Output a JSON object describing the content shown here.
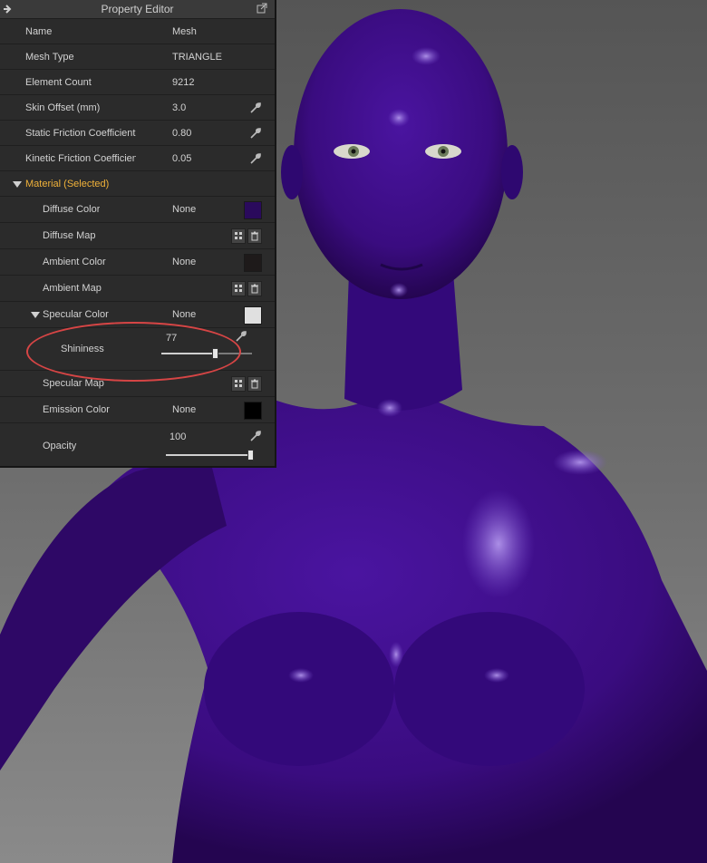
{
  "panel": {
    "title": "Property Editor",
    "rows": [
      {
        "label": "Name",
        "value": "Mesh"
      },
      {
        "label": "Mesh Type",
        "value": "TRIANGLE"
      },
      {
        "label": "Element Count",
        "value": "9212"
      },
      {
        "label": "Skin Offset (mm)",
        "value": "3.0"
      },
      {
        "label": "Static Friction Coefficient",
        "value": "0.80"
      },
      {
        "label": "Kinetic Friction Coefficient",
        "value": "0.05"
      }
    ],
    "material": {
      "title": "Material (Selected)",
      "diffuse_color": {
        "label": "Diffuse Color",
        "value": "None",
        "color": "#2a0a5c"
      },
      "diffuse_map": {
        "label": "Diffuse Map"
      },
      "ambient_color": {
        "label": "Ambient Color",
        "value": "None",
        "color": "#1e1a1a"
      },
      "ambient_map": {
        "label": "Ambient Map"
      },
      "specular_color": {
        "label": "Specular Color",
        "value": "None",
        "color": "#e0e0e0"
      },
      "shininess": {
        "label": "Shininess",
        "value": "77",
        "level": 0.59
      },
      "specular_map": {
        "label": "Specular Map"
      },
      "emission_color": {
        "label": "Emission Color",
        "value": "None",
        "color": "#000000"
      },
      "opacity": {
        "label": "Opacity",
        "value": "100",
        "level": 0.96
      }
    }
  },
  "viewport": {
    "body_color": "#3b0b7f",
    "annotation_color": "#d64545"
  }
}
